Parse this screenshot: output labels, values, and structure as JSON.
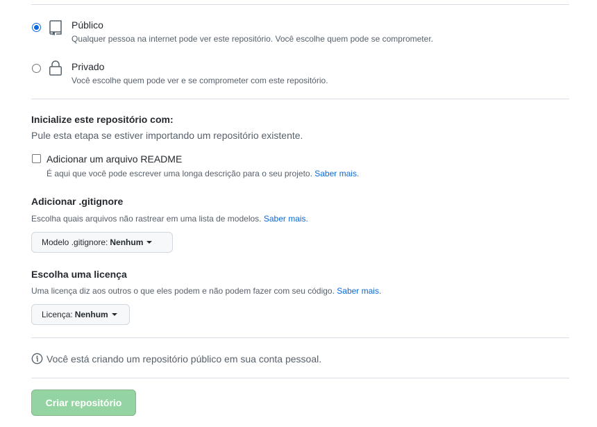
{
  "visibility": {
    "options": [
      {
        "title": "Público",
        "description": "Qualquer pessoa na internet pode ver este repositório. Você escolhe quem pode se comprometer.",
        "selected": true,
        "icon": "repo-icon"
      },
      {
        "title": "Privado",
        "description": "Você escolhe quem pode ver e se comprometer com este repositório.",
        "selected": false,
        "icon": "lock-icon"
      }
    ]
  },
  "initialize": {
    "title": "Inicialize este repositório com:",
    "subtitle": "Pule esta etapa se estiver importando um repositório existente.",
    "readme": {
      "label": "Adicionar um arquivo README",
      "description": "É aqui que você pode escrever uma longa descrição para o seu projeto.",
      "link": "Saber mais.",
      "checked": false
    }
  },
  "gitignore": {
    "title": "Adicionar .gitignore",
    "description": "Escolha quais arquivos não rastrear em uma lista de modelos.",
    "link": "Saber mais.",
    "select_label": "Modelo .gitignore:",
    "select_value": "Nenhum"
  },
  "license": {
    "title": "Escolha uma licença",
    "description": "Uma licença diz aos outros o que eles podem e não podem fazer com seu código.",
    "link": "Saber mais.",
    "select_label": "Licença:",
    "select_value": "Nenhum"
  },
  "notice": {
    "text": "Você está criando um repositório público em sua conta pessoal.",
    "icon": "info-icon"
  },
  "submit": {
    "label": "Criar repositório",
    "disabled": true
  },
  "colors": {
    "accent": "#0969da",
    "button_disabled": "#94d3a2",
    "muted_text": "#57606a"
  }
}
